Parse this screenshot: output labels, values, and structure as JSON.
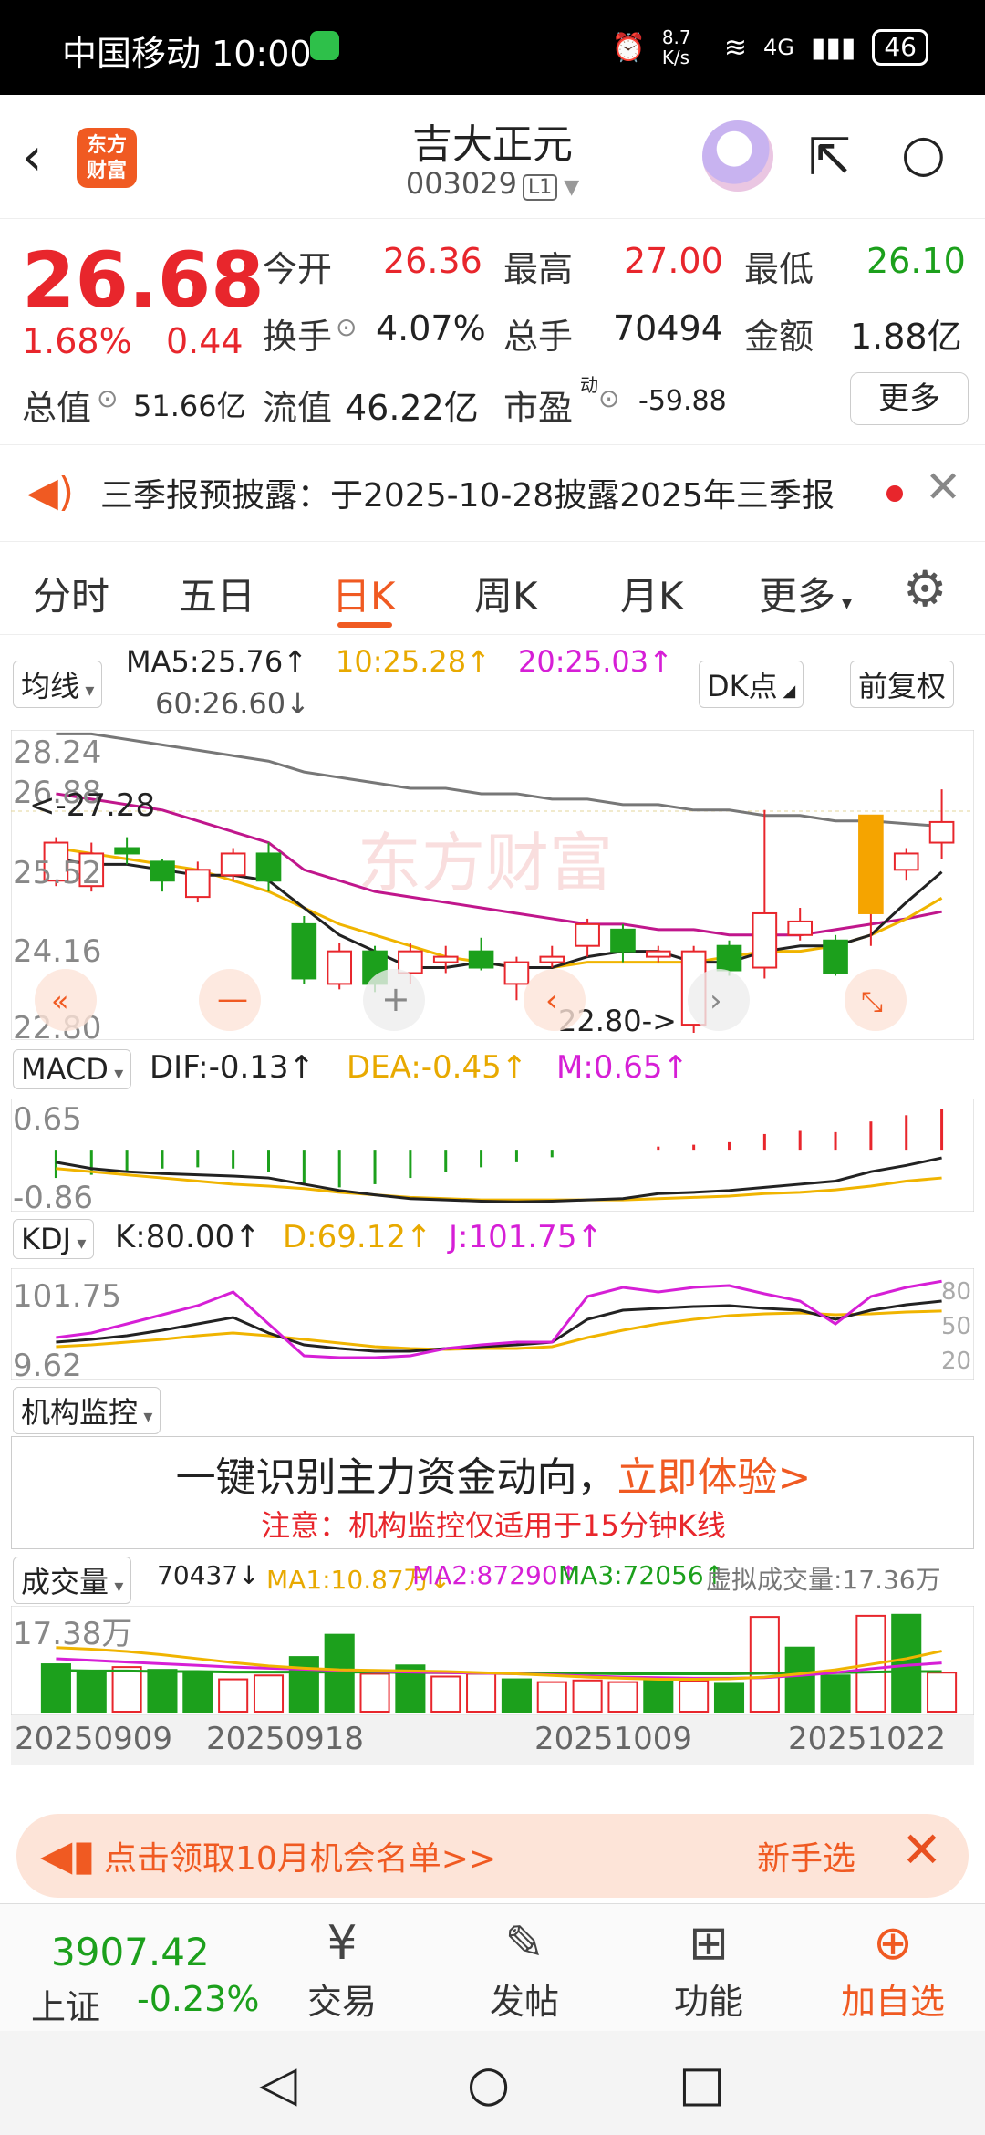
{
  "status_bar": {
    "carrier_time": "中国移动 10:00",
    "net_speed": "8.7 K/s",
    "signal": "4G",
    "battery": "46"
  },
  "nav": {
    "stock_name": "吉大正元",
    "stock_code": "003029",
    "level": "L1",
    "logo_text_1": "东方",
    "logo_text_2": "财富"
  },
  "quote": {
    "price": "26.68",
    "change_pct": "1.68%",
    "change_amt": "0.44",
    "open_label": "今开",
    "open": "26.36",
    "high_label": "最高",
    "high": "27.00",
    "low_label": "最低",
    "low": "26.10",
    "turnover_label": "换手",
    "turnover": "4.07%",
    "volume_label": "总手",
    "volume": "70494",
    "amount_label": "金额",
    "amount": "1.88亿",
    "mktcap_label": "总值",
    "mktcap": "51.66亿",
    "float_label": "流值",
    "float_cap": "46.22亿",
    "pe_label": "市盈",
    "pe_sup": "动",
    "pe": "-59.88",
    "more": "更多"
  },
  "notice": {
    "text": "三季报预披露：于2025-10-28披露2025年三季报"
  },
  "tabs": [
    "分时",
    "五日",
    "日K",
    "周K",
    "月K",
    "更多"
  ],
  "active_tab": "日K",
  "ma_row": {
    "selector": "均线",
    "ma5": "MA5:25.76↑",
    "ma10": "10:25.28↑",
    "ma20": "20:25.03↑",
    "ma60": "60:26.60↓",
    "dk": "DK点",
    "adjust": "前复权"
  },
  "kline_axis": [
    "28.24",
    "26.88",
    "25.52",
    "24.16",
    "22.80"
  ],
  "kline_labels": {
    "high_marker": "<-27.28",
    "low_marker": "22.80->"
  },
  "watermark": "东方财富",
  "macd": {
    "selector": "MACD",
    "dif": "DIF:-0.13↑",
    "dea": "DEA:-0.45↑",
    "m": "M:0.65↑",
    "axis_top": "0.65",
    "axis_bottom": "-0.86"
  },
  "kdj": {
    "selector": "KDJ",
    "k": "K:80.00↑",
    "d": "D:69.12↑",
    "j": "J:101.75↑",
    "axis_top": "101.75",
    "axis_bottom": "9.62",
    "levels": [
      "80",
      "50",
      "20"
    ]
  },
  "institution": {
    "selector": "机构监控",
    "line1": "一键识别主力资金动向，",
    "line1_link": "立即体验>",
    "line2": "注意：机构监控仅适用于15分钟K线"
  },
  "volume": {
    "selector": "成交量",
    "val": "70437↓",
    "ma1": "MA1:10.87万↓",
    "ma2": "MA2:87290↑",
    "ma3": "MA3:72056↑",
    "virtual": "虚拟成交量:17.36万",
    "axis_top": "17.38万"
  },
  "date_axis": [
    "20250909",
    "20250918",
    "20251009",
    "20251022"
  ],
  "promo": {
    "text": "点击领取10月机会名单>>",
    "right": "新手选"
  },
  "toolbar": {
    "index_value": "3907.42",
    "index_name": "上证",
    "index_change": "-0.23%",
    "trade": "交易",
    "post": "发帖",
    "function": "功能",
    "add": "加自选"
  },
  "chart_data": {
    "type": "candlestick",
    "ylim": [
      22.8,
      28.24
    ],
    "candles": [
      {
        "o": 25.6,
        "c": 26.3,
        "h": 26.4,
        "l": 25.5
      },
      {
        "o": 25.5,
        "c": 26.1,
        "h": 26.3,
        "l": 25.4
      },
      {
        "o": 26.2,
        "c": 26.1,
        "h": 26.4,
        "l": 25.9
      },
      {
        "o": 25.95,
        "c": 25.6,
        "h": 26.0,
        "l": 25.4
      },
      {
        "o": 25.3,
        "c": 25.8,
        "h": 25.95,
        "l": 25.2
      },
      {
        "o": 25.7,
        "c": 26.1,
        "h": 26.2,
        "l": 25.6
      },
      {
        "o": 26.1,
        "c": 25.6,
        "h": 26.3,
        "l": 25.4
      },
      {
        "o": 24.8,
        "c": 23.8,
        "h": 24.95,
        "l": 23.7
      },
      {
        "o": 23.7,
        "c": 24.3,
        "h": 24.45,
        "l": 23.6
      },
      {
        "o": 24.3,
        "c": 23.7,
        "h": 24.4,
        "l": 23.55
      },
      {
        "o": 23.9,
        "c": 24.3,
        "h": 24.45,
        "l": 23.7
      },
      {
        "o": 24.1,
        "c": 24.2,
        "h": 24.4,
        "l": 23.9
      },
      {
        "o": 24.3,
        "c": 24.0,
        "h": 24.55,
        "l": 23.95
      },
      {
        "o": 23.7,
        "c": 24.1,
        "h": 24.2,
        "l": 23.4
      },
      {
        "o": 24.1,
        "c": 24.2,
        "h": 24.4,
        "l": 24.0
      },
      {
        "o": 24.4,
        "c": 24.8,
        "h": 24.9,
        "l": 24.2
      },
      {
        "o": 24.7,
        "c": 24.3,
        "h": 24.8,
        "l": 24.1
      },
      {
        "o": 24.2,
        "c": 24.3,
        "h": 24.4,
        "l": 24.1
      },
      {
        "o": 22.95,
        "c": 24.3,
        "h": 24.4,
        "l": 22.8
      },
      {
        "o": 24.4,
        "c": 23.95,
        "h": 24.5,
        "l": 23.85
      },
      {
        "o": 24.0,
        "c": 25.0,
        "h": 26.9,
        "l": 23.8
      },
      {
        "o": 24.6,
        "c": 24.85,
        "h": 25.1,
        "l": 24.5
      },
      {
        "o": 24.5,
        "c": 23.9,
        "h": 24.6,
        "l": 23.85
      },
      {
        "o": 25.0,
        "c": 26.8,
        "h": 26.8,
        "l": 24.4
      },
      {
        "o": 25.8,
        "c": 26.1,
        "h": 26.2,
        "l": 25.6
      },
      {
        "o": 26.3,
        "c": 26.68,
        "h": 27.28,
        "l": 26.0
      }
    ],
    "ma5": [
      26.0,
      25.9,
      25.9,
      25.8,
      25.7,
      25.7,
      25.6,
      25.1,
      24.6,
      24.3,
      24.0,
      24.0,
      24.1,
      24.0,
      24.0,
      24.2,
      24.3,
      24.3,
      24.1,
      24.1,
      24.3,
      24.4,
      24.4,
      24.6,
      25.2,
      25.76
    ],
    "ma10": [
      26.2,
      26.1,
      26.0,
      25.9,
      25.8,
      25.6,
      25.4,
      25.1,
      24.8,
      24.6,
      24.4,
      24.2,
      24.1,
      24.0,
      24.0,
      24.1,
      24.1,
      24.1,
      24.1,
      24.2,
      24.3,
      24.3,
      24.4,
      24.6,
      24.9,
      25.28
    ],
    "ma20": [
      27.2,
      27.1,
      27.0,
      26.9,
      26.7,
      26.5,
      26.3,
      25.8,
      25.6,
      25.4,
      25.3,
      25.2,
      25.1,
      25.0,
      24.9,
      24.8,
      24.8,
      24.7,
      24.7,
      24.6,
      24.6,
      24.6,
      24.7,
      24.8,
      24.9,
      25.03
    ],
    "ma60": [
      28.3,
      28.3,
      28.2,
      28.1,
      28.0,
      27.9,
      27.8,
      27.6,
      27.5,
      27.4,
      27.3,
      27.3,
      27.2,
      27.2,
      27.1,
      27.1,
      27.0,
      27.0,
      26.9,
      26.9,
      26.8,
      26.8,
      26.7,
      26.7,
      26.65,
      26.6
    ],
    "macd_hist": [
      -0.45,
      -0.4,
      -0.35,
      -0.3,
      -0.28,
      -0.3,
      -0.35,
      -0.55,
      -0.6,
      -0.55,
      -0.45,
      -0.35,
      -0.28,
      -0.2,
      -0.12,
      -0.02,
      0.02,
      0.05,
      0.08,
      0.12,
      0.25,
      0.3,
      0.28,
      0.45,
      0.55,
      0.65
    ],
    "macd_dif": [
      -0.2,
      -0.3,
      -0.35,
      -0.38,
      -0.4,
      -0.42,
      -0.45,
      -0.55,
      -0.65,
      -0.72,
      -0.78,
      -0.8,
      -0.82,
      -0.83,
      -0.82,
      -0.8,
      -0.78,
      -0.7,
      -0.68,
      -0.65,
      -0.6,
      -0.55,
      -0.5,
      -0.35,
      -0.25,
      -0.13
    ],
    "macd_dea": [
      -0.3,
      -0.35,
      -0.4,
      -0.45,
      -0.5,
      -0.55,
      -0.58,
      -0.62,
      -0.68,
      -0.72,
      -0.76,
      -0.78,
      -0.8,
      -0.8,
      -0.8,
      -0.8,
      -0.8,
      -0.78,
      -0.76,
      -0.74,
      -0.7,
      -0.68,
      -0.64,
      -0.58,
      -0.5,
      -0.45
    ],
    "kdj_k": [
      35,
      38,
      42,
      48,
      55,
      62,
      45,
      32,
      28,
      25,
      25,
      28,
      30,
      32,
      35,
      60,
      70,
      72,
      74,
      75,
      72,
      70,
      60,
      70,
      76,
      80.0
    ],
    "kdj_d": [
      30,
      32,
      35,
      38,
      42,
      45,
      42,
      38,
      34,
      30,
      28,
      27,
      28,
      28,
      30,
      40,
      48,
      55,
      60,
      64,
      66,
      67,
      65,
      66,
      68,
      69.12
    ],
    "kdj_j": [
      40,
      45,
      55,
      65,
      75,
      90,
      55,
      20,
      18,
      18,
      20,
      28,
      32,
      35,
      35,
      85,
      95,
      90,
      95,
      97,
      88,
      80,
      55,
      85,
      95,
      101.75
    ],
    "volume": [
      8.5,
      7.0,
      8.0,
      7.5,
      7.0,
      5.8,
      6.5,
      9.8,
      13.8,
      6.8,
      8.3,
      6.3,
      6.8,
      5.8,
      5.3,
      5.6,
      5.3,
      5.6,
      5.5,
      5.0,
      17.0,
      11.5,
      6.5,
      17.2,
      17.38,
      7.0
    ],
    "vol_up": [
      0,
      0,
      1,
      0,
      0,
      1,
      1,
      0,
      0,
      1,
      0,
      1,
      1,
      0,
      1,
      1,
      1,
      0,
      1,
      0,
      1,
      0,
      0,
      1,
      0,
      1
    ],
    "vol_ma1": [
      11.5,
      11.2,
      10.8,
      10.2,
      9.5,
      8.8,
      8.2,
      7.8,
      7.5,
      7.4,
      7.3,
      7.2,
      7.0,
      6.8,
      6.5,
      6.2,
      6.0,
      5.8,
      5.8,
      5.9,
      6.2,
      6.8,
      7.5,
      8.5,
      9.5,
      10.87
    ],
    "vol_ma2": [
      9.5,
      9.2,
      8.9,
      8.6,
      8.3,
      8.0,
      7.8,
      7.6,
      7.4,
      7.2,
      7.1,
      7.0,
      6.9,
      6.8,
      6.6,
      6.4,
      6.2,
      6.1,
      6.0,
      6.0,
      6.1,
      6.5,
      7.0,
      7.7,
      8.3,
      8.73
    ],
    "vol_ma3": [
      7.4,
      7.3,
      7.3,
      7.2,
      7.2,
      7.1,
      7.1,
      7.1,
      7.1,
      7.1,
      7.0,
      7.0,
      6.9,
      6.9,
      6.9,
      6.9,
      6.8,
      6.8,
      6.8,
      6.8,
      6.9,
      6.9,
      7.0,
      7.1,
      7.2,
      7.21
    ]
  }
}
